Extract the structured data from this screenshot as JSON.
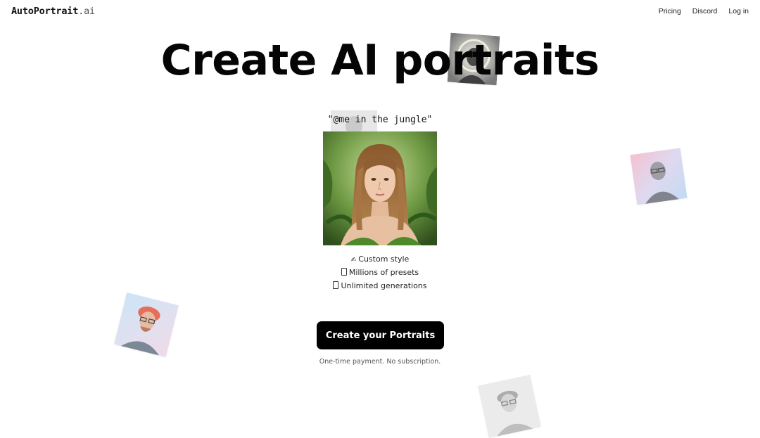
{
  "brand": {
    "name": "AutoPortrait",
    "tld": ".ai"
  },
  "nav": {
    "pricing": "Pricing",
    "discord": "Discord",
    "login": "Log in"
  },
  "hero": {
    "headline": "Create AI portraits",
    "prompt": "\"@me in the jungle\""
  },
  "features": [
    {
      "icon": "writing-hand-icon",
      "glyph": "✍",
      "label": "Custom style"
    },
    {
      "icon": "presets-box-icon",
      "label": "Millions of presets"
    },
    {
      "icon": "generations-box-icon",
      "label": "Unlimited generations"
    }
  ],
  "cta": {
    "label": "Create your Portraits",
    "note": "One-time payment. No subscription."
  }
}
